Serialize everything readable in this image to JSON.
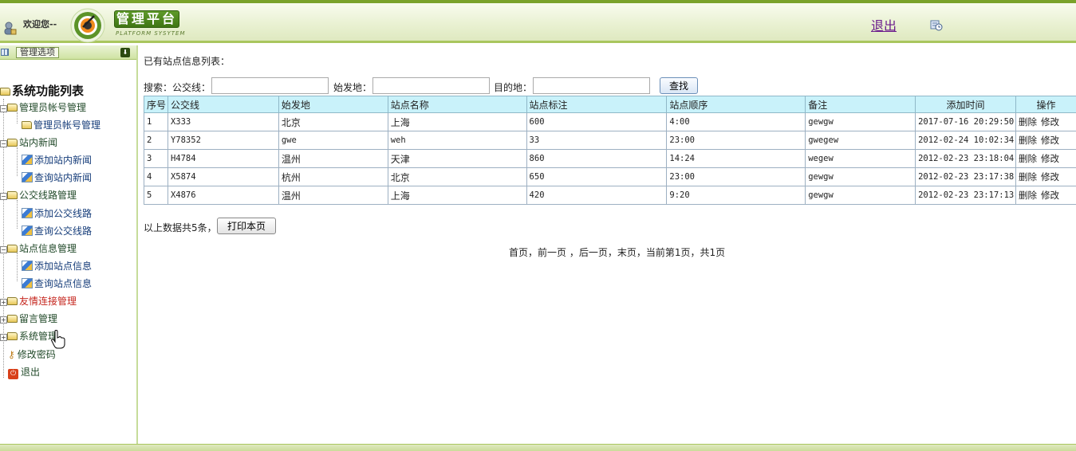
{
  "header": {
    "welcome": "欢迎您--",
    "title": "管理平台",
    "subtitle": "PLATFORM SYSYTEM",
    "logout": "退出"
  },
  "sidebar": {
    "menu_button": "管理选项",
    "root": "系统功能列表",
    "groups": [
      {
        "label": "管理员帐号管理",
        "children": [
          "管理员帐号管理"
        ]
      },
      {
        "label": "站内新闻",
        "children": [
          "添加站内新闻",
          "查询站内新闻"
        ]
      },
      {
        "label": "公交线路管理",
        "children": [
          "添加公交线路",
          "查询公交线路"
        ]
      },
      {
        "label": "站点信息管理",
        "children": [
          "添加站点信息",
          "查询站点信息"
        ]
      },
      {
        "label": "友情连接管理",
        "children": []
      },
      {
        "label": "留言管理",
        "children": []
      },
      {
        "label": "系统管理",
        "children": []
      }
    ],
    "change_password": "修改密码",
    "exit": "退出"
  },
  "main": {
    "list_title": "已有站点信息列表：",
    "search": {
      "prefix": "搜索：",
      "line_label": "公交线：",
      "start_label": "始发地：",
      "dest_label": "目的地：",
      "button": "查找"
    },
    "table": {
      "headers": [
        "序号",
        "公交线",
        "始发地",
        "站点名称",
        "站点标注",
        "站点顺序",
        "备注",
        "添加时间",
        "操作"
      ],
      "rows": [
        [
          "1",
          "X333",
          "北京",
          "上海",
          "600",
          "4:00",
          "gewgw",
          "2017-07-16 20:29:50"
        ],
        [
          "2",
          "Y78352",
          "gwe",
          "weh",
          "33",
          "23:00",
          "gwegew",
          "2012-02-24 10:02:34"
        ],
        [
          "3",
          "H4784",
          "温州",
          "天津",
          "860",
          "14:24",
          "wegew",
          "2012-02-23 23:18:04"
        ],
        [
          "4",
          "X5874",
          "杭州",
          "北京",
          "650",
          "23:00",
          "gewgw",
          "2012-02-23 23:17:38"
        ],
        [
          "5",
          "X4876",
          "温州",
          "上海",
          "420",
          "9:20",
          "gewgw",
          "2012-02-23 23:17:13"
        ]
      ],
      "op_delete": "删除",
      "op_edit": "修改"
    },
    "summary": "以上数据共5条，",
    "print_button": "打印本页",
    "pager": "首页，前一页 ，后一页，末页，当前第1页，共1页"
  }
}
